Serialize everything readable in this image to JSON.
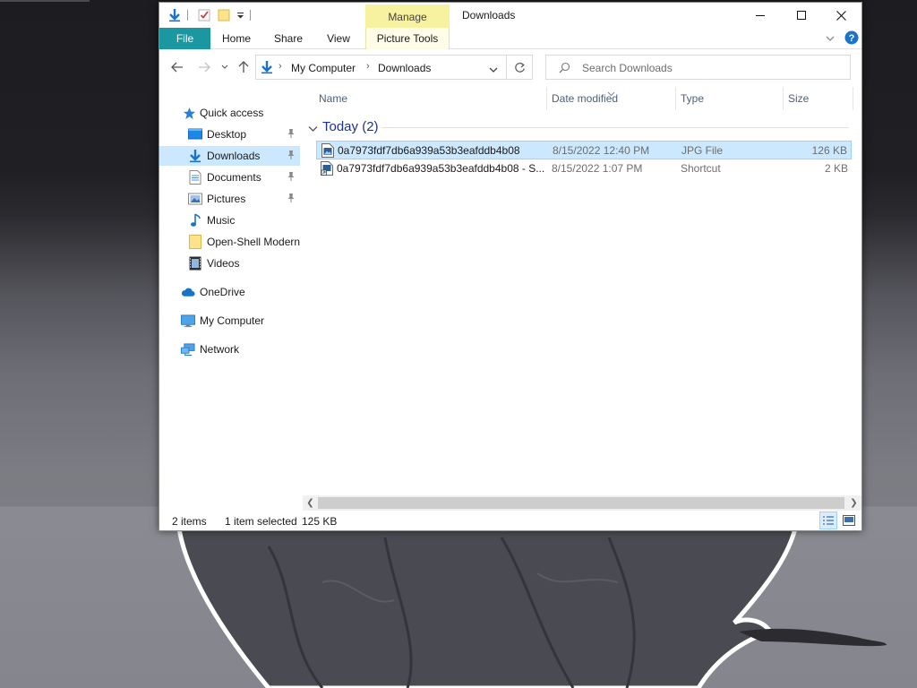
{
  "window": {
    "title": "Downloads",
    "context_tab_group": "Manage",
    "minimize_label": "Minimize",
    "maximize_label": "Maximize",
    "close_label": "Close"
  },
  "ribbon": {
    "tabs": [
      {
        "label": "File"
      },
      {
        "label": "Home"
      },
      {
        "label": "Share"
      },
      {
        "label": "View"
      },
      {
        "label": "Picture Tools"
      }
    ]
  },
  "address": {
    "crumbs": [
      "My Computer",
      "Downloads"
    ]
  },
  "search": {
    "placeholder": "Search Downloads"
  },
  "navpane": {
    "items": [
      {
        "label": "Quick access",
        "icon": "star-icon"
      },
      {
        "label": "Desktop",
        "icon": "desktop-folder-icon",
        "pinned": true
      },
      {
        "label": "Downloads",
        "icon": "download-arrow-icon",
        "pinned": true,
        "selected": true
      },
      {
        "label": "Documents",
        "icon": "documents-icon",
        "pinned": true
      },
      {
        "label": "Pictures",
        "icon": "pictures-icon",
        "pinned": true
      },
      {
        "label": "Music",
        "icon": "music-note-icon"
      },
      {
        "label": "Open-Shell Modern",
        "icon": "folder-icon"
      },
      {
        "label": "Videos",
        "icon": "film-icon"
      },
      {
        "label": "OneDrive",
        "icon": "cloud-icon"
      },
      {
        "label": "My Computer",
        "icon": "computer-icon"
      },
      {
        "label": "Network",
        "icon": "network-icon"
      }
    ]
  },
  "columns": [
    "Name",
    "Date modified",
    "Type",
    "Size"
  ],
  "group": {
    "label": "Today (2)"
  },
  "files": [
    {
      "name": "0a7973fdf7db6a939a53b3eafddb4b08",
      "date": "8/15/2022 12:40 PM",
      "type": "JPG File",
      "size": "126 KB",
      "selected": true,
      "icon": "image-file-icon"
    },
    {
      "name": "0a7973fdf7db6a939a53b3eafddb4b08 - S...",
      "date": "8/15/2022 1:07 PM",
      "type": "Shortcut",
      "size": "2 KB",
      "selected": false,
      "icon": "shortcut-file-icon"
    }
  ],
  "status": {
    "items_count": "2 items",
    "selection": "1 item selected",
    "selection_size": "125 KB"
  },
  "colors": {
    "file_tab": "#1b97a1",
    "context_tab": "#f7f2a0",
    "selection": "#cce8ff",
    "group_header": "#1e3287",
    "accent_blue": "#1a73c9"
  }
}
